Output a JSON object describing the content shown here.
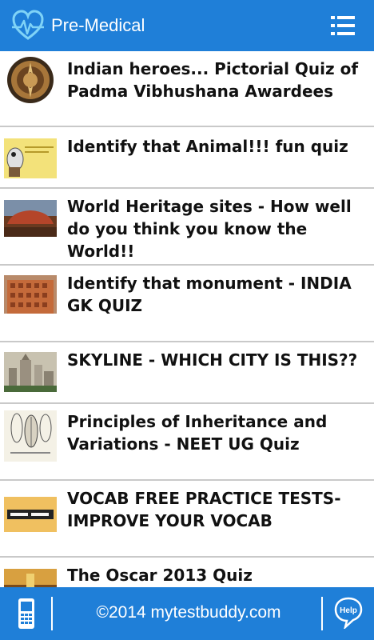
{
  "app_bar": {
    "title": "Pre-Medical",
    "logo_icon": "heart-pulse-icon",
    "menu_icon": "list-menu-icon"
  },
  "quiz_list": [
    {
      "title": "Indian heroes... Pictorial Quiz of Padma Vibhushana Awardees",
      "thumbnail": "padma-medal-icon"
    },
    {
      "title": "Identify that Animal!!! fun quiz",
      "thumbnail": "animal-quiz-card-icon"
    },
    {
      "title": "World Heritage sites - How well do you think you know the World!!",
      "thumbnail": "uluru-rock-icon"
    },
    {
      "title": "Identify that monument - INDIA GK QUIZ",
      "thumbnail": "hawa-mahal-icon"
    },
    {
      "title": "SKYLINE - WHICH CITY IS THIS??",
      "thumbnail": "city-skyline-icon"
    },
    {
      "title": "Principles of Inheritance and Variations - NEET UG Quiz",
      "thumbnail": "botanical-leaves-icon"
    },
    {
      "title": "VOCAB FREE PRACTICE TESTS- IMPROVE YOUR VOCAB",
      "thumbnail": "english-vocab-icon"
    },
    {
      "title": "The Oscar 2013 Quiz",
      "thumbnail": "oscar-stage-icon"
    }
  ],
  "footer": {
    "copyright": "©2014 mytestbuddy.com",
    "phone_icon": "mobile-phone-icon",
    "help_label": "Help"
  },
  "colors": {
    "primary": "#1f7fd8",
    "divider": "#c9c9c9",
    "text": "#111111"
  }
}
